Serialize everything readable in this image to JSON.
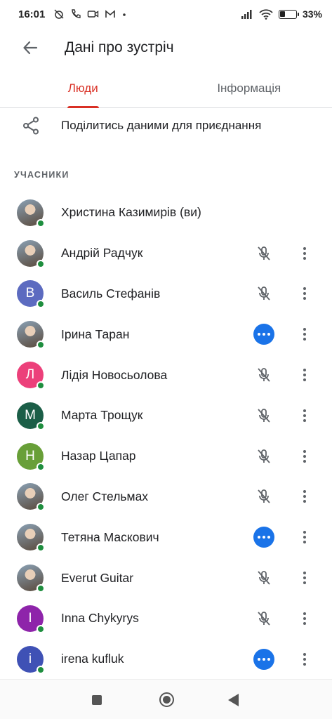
{
  "status_bar": {
    "time": "16:01",
    "battery_percent": "33",
    "battery_suffix": "%",
    "battery_level": 0.33,
    "left_icons": [
      "alarm-off-icon",
      "call-icon",
      "video-icon",
      "gmail-icon",
      "dot-icon"
    ],
    "right_icons": [
      "signal-icon",
      "wifi-icon",
      "battery-icon"
    ]
  },
  "app_bar": {
    "title": "Дані про зустріч",
    "back_icon": "arrow-back-icon"
  },
  "tabs": [
    {
      "label": "Люди",
      "active": true
    },
    {
      "label": "Інформація",
      "active": false
    }
  ],
  "share": {
    "label": "Поділитись даними для приєднання",
    "icon": "share-icon"
  },
  "participants_header": "УЧАСНИКИ",
  "participants": [
    {
      "name": "Христина Казимирів (ви)",
      "avatar_type": "photo",
      "initial": "",
      "avatar_color": "",
      "control": "none"
    },
    {
      "name": "Андрій Радчук",
      "avatar_type": "photo",
      "initial": "",
      "avatar_color": "",
      "control": "muted"
    },
    {
      "name": "Василь Стефанів",
      "avatar_type": "letter",
      "initial": "В",
      "avatar_color": "#5c6bc0",
      "control": "muted"
    },
    {
      "name": "Ірина Таран",
      "avatar_type": "photo",
      "initial": "",
      "avatar_color": "",
      "control": "speaking"
    },
    {
      "name": "Лідія Новосьолова",
      "avatar_type": "letter",
      "initial": "Л",
      "avatar_color": "#ec407a",
      "control": "muted"
    },
    {
      "name": "Марта Трощук",
      "avatar_type": "letter",
      "initial": "М",
      "avatar_color": "#1b5e47",
      "control": "muted"
    },
    {
      "name": "Назар Цапар",
      "avatar_type": "letter",
      "initial": "Н",
      "avatar_color": "#689f38",
      "control": "muted"
    },
    {
      "name": "Олег Стельмах",
      "avatar_type": "photo",
      "initial": "",
      "avatar_color": "",
      "control": "muted"
    },
    {
      "name": "Тетяна Маскович",
      "avatar_type": "photo",
      "initial": "",
      "avatar_color": "",
      "control": "speaking"
    },
    {
      "name": "Everut Guitar",
      "avatar_type": "photo",
      "initial": "",
      "avatar_color": "",
      "control": "muted"
    },
    {
      "name": "Inna Chykyrys",
      "avatar_type": "letter",
      "initial": "I",
      "avatar_color": "#8e24aa",
      "control": "muted"
    },
    {
      "name": "irena kufluk",
      "avatar_type": "letter",
      "initial": "i",
      "avatar_color": "#3f51b5",
      "control": "speaking"
    }
  ],
  "colors": {
    "accent": "#d93025",
    "online": "#1e8e3e",
    "speaking": "#1a73e8"
  },
  "nav_bar": {
    "icons": [
      "recents-square-icon",
      "home-circle-icon",
      "back-triangle-icon"
    ]
  }
}
